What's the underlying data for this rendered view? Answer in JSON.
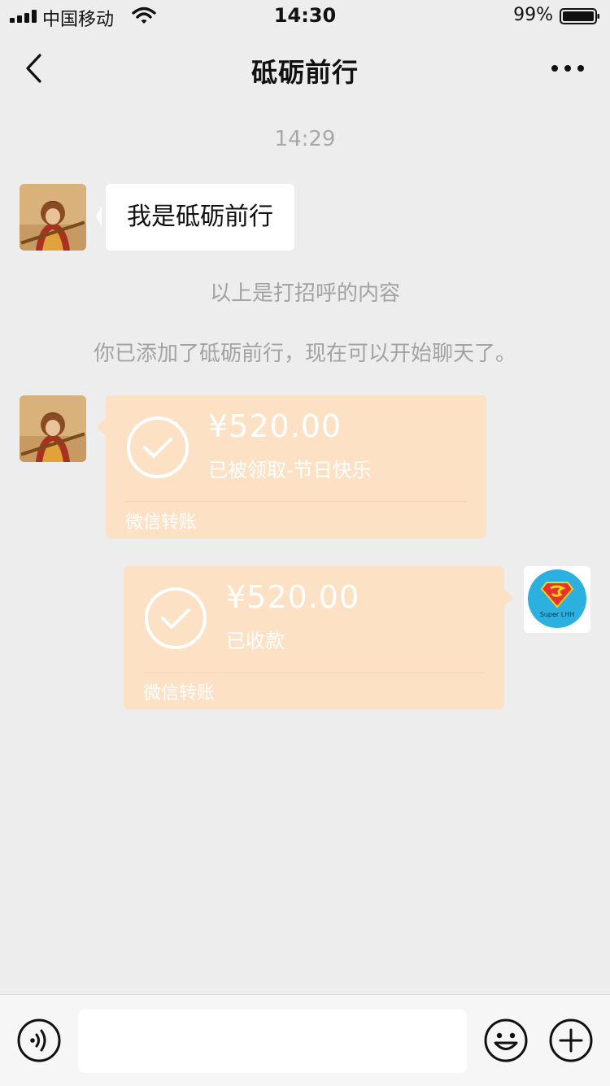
{
  "status": {
    "carrier": "中国移动",
    "time": "14:30",
    "battery": "99%"
  },
  "header": {
    "title": "砥砺前行"
  },
  "chat": {
    "timestamp": "14:29",
    "greeting_message": "我是砥砺前行",
    "system_notes": [
      "以上是打招呼的内容",
      "你已添加了砥砺前行，现在可以开始聊天了。"
    ],
    "transfers": [
      {
        "amount": "¥520.00",
        "description": "已被领取-节日快乐",
        "footer": "微信转账"
      },
      {
        "amount": "¥520.00",
        "description": "已收款",
        "footer": "微信转账"
      }
    ],
    "my_avatar_text": "Super LHH"
  },
  "colors": {
    "transfer_bg": "#fce1c4",
    "page_bg": "#ededed"
  }
}
